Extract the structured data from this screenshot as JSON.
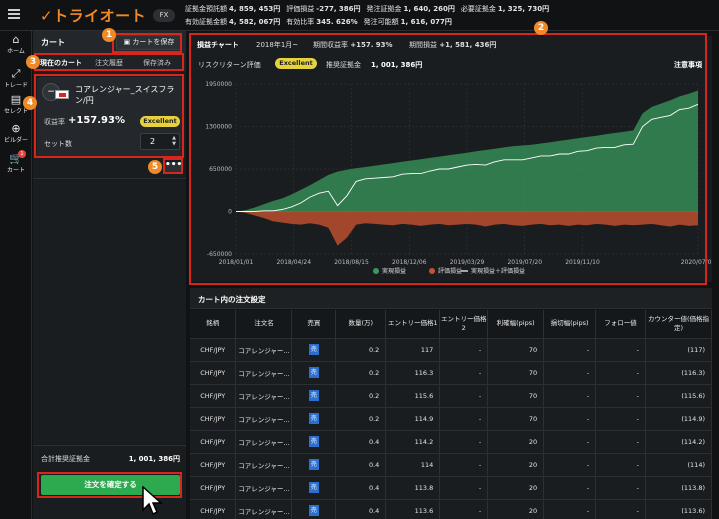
{
  "header": {
    "brand": "トライオート",
    "product_tag": "FX",
    "stats_row1": [
      {
        "label": "証拠金預託額",
        "value": "4, 859, 453円"
      },
      {
        "label": "評価損益",
        "value": "-277, 386円"
      },
      {
        "label": "発注証拠金",
        "value": "1, 640, 260円"
      },
      {
        "label": "必要証拠金",
        "value": "1, 325, 730円"
      }
    ],
    "stats_row2": [
      {
        "label": "有効証拠金額",
        "value": "4, 582, 067円"
      },
      {
        "label": "有効比率",
        "value": "345. 626%"
      },
      {
        "label": "発注可能額",
        "value": "1, 616, 077円"
      }
    ]
  },
  "rail": {
    "items": [
      {
        "label": "ホーム",
        "icon": "home-icon",
        "glyph": "⌂"
      },
      {
        "label": "トレード",
        "icon": "trade-icon",
        "glyph": "⤢"
      },
      {
        "label": "セレクト",
        "icon": "select-icon",
        "glyph": "▤"
      },
      {
        "label": "ビルダー",
        "icon": "builder-icon",
        "glyph": "⊕"
      },
      {
        "label": "カート",
        "icon": "cart-icon",
        "glyph": "🛒",
        "badge": "1"
      }
    ]
  },
  "cart": {
    "title": "カート",
    "save_label": "カートを保存",
    "tabs": [
      "現在のカート",
      "注文履歴",
      "保存済み"
    ],
    "item": {
      "name": "コアレンジャー_スイスフラン/円",
      "profit_label": "収益率",
      "profit_value": "+157.93%",
      "rating": "Excellent",
      "sets_label": "セット数",
      "sets_value": "2"
    },
    "more_label": "•••",
    "total_label": "合計推奨証拠金",
    "total_value": "1, 001, 386円",
    "confirm_label": "注文を確定する"
  },
  "markers": [
    "1",
    "2",
    "3",
    "4",
    "5"
  ],
  "chart_tabs": {
    "active": "損益チャート",
    "period": "2018年1月~",
    "return_label": "期間収益率",
    "return_value": "+157. 93%",
    "pnl_label": "期間損益",
    "pnl_value": "+1, 581, 436円"
  },
  "chart_info": {
    "risk_label": "リスクリターン評価",
    "risk_value": "Excellent",
    "rec_label": "推奨証拠金",
    "rec_value": "1, 001, 386円",
    "notes_label": "注意事項"
  },
  "chart_data": {
    "type": "area",
    "x_ticks": [
      "2018/01/01",
      "2018/04/24",
      "2018/08/15",
      "2018/12/06",
      "2019/03/29",
      "2019/07/20",
      "2019/11/10",
      "2020/07/06"
    ],
    "y_ticks": [
      1950000,
      1300000,
      650000,
      0,
      -650000
    ],
    "y_tick_labels": [
      "1950000",
      "1300000",
      "650000",
      "0",
      "-650000"
    ],
    "ylim": [
      -650000,
      1950000
    ],
    "grid": true,
    "legend_position": "bottom",
    "series": [
      {
        "name": "実現損益",
        "color": "#3a9a5c",
        "values": [
          0,
          20000,
          60000,
          110000,
          160000,
          200000,
          260000,
          330000,
          400000,
          480000,
          560000,
          610000,
          640000,
          660000,
          680000,
          700000,
          720000,
          740000,
          760000,
          780000,
          800000,
          820000,
          840000,
          860000,
          880000,
          900000,
          920000,
          940000,
          960000,
          980000,
          1000000,
          1010000,
          1020000,
          1040000,
          1060000,
          1080000,
          1100000,
          1120000,
          1140000,
          1160000,
          1180000,
          1200000,
          1220000,
          1240000,
          1500000,
          1600000,
          1650000,
          1700000,
          1760000,
          1800000,
          1850000
        ]
      },
      {
        "name": "評価損益",
        "color": "#c4532e",
        "values": [
          0,
          -20000,
          -60000,
          -100000,
          -150000,
          -170000,
          -190000,
          -200000,
          -180000,
          -200000,
          -250000,
          -520000,
          -400000,
          -200000,
          -180000,
          -190000,
          -200000,
          -210000,
          -190000,
          -200000,
          -220000,
          -200000,
          -190000,
          -210000,
          -200000,
          -190000,
          -200000,
          -230000,
          -200000,
          -190000,
          -210000,
          -220000,
          -200000,
          -190000,
          -210000,
          -200000,
          -220000,
          -200000,
          -210000,
          -190000,
          -200000,
          -220000,
          -200000,
          -210000,
          -200000,
          -190000,
          -210000,
          -230000,
          -200000,
          -220000,
          -210000
        ]
      },
      {
        "name": "実現損益＋評価損益",
        "color": "#ffffff",
        "values": [
          0,
          0,
          0,
          10000,
          10000,
          30000,
          70000,
          130000,
          220000,
          280000,
          310000,
          90000,
          240000,
          460000,
          500000,
          510000,
          520000,
          530000,
          570000,
          580000,
          580000,
          620000,
          650000,
          650000,
          680000,
          710000,
          720000,
          710000,
          760000,
          790000,
          790000,
          790000,
          820000,
          850000,
          850000,
          880000,
          880000,
          920000,
          930000,
          970000,
          980000,
          980000,
          1020000,
          1030000,
          1300000,
          1410000,
          1440000,
          1470000,
          1560000,
          1580000,
          1640000
        ]
      }
    ]
  },
  "order": {
    "title": "カート内の注文設定",
    "columns": [
      "銘柄",
      "注文名",
      "売買",
      "数量(万)",
      "エントリー価格1",
      "エントリー価格2",
      "利確幅(pips)",
      "損切幅(pips)",
      "フォロー値",
      "カウンター値(価格指定)"
    ],
    "rows": [
      [
        "CHF/JPY",
        "コアレンジャー...",
        "売",
        "0.2",
        "117",
        "-",
        "70",
        "-",
        "-",
        "(117)"
      ],
      [
        "CHF/JPY",
        "コアレンジャー...",
        "売",
        "0.2",
        "116.3",
        "-",
        "70",
        "-",
        "-",
        "(116.3)"
      ],
      [
        "CHF/JPY",
        "コアレンジャー...",
        "売",
        "0.2",
        "115.6",
        "-",
        "70",
        "-",
        "-",
        "(115.6)"
      ],
      [
        "CHF/JPY",
        "コアレンジャー...",
        "売",
        "0.2",
        "114.9",
        "-",
        "70",
        "-",
        "-",
        "(114.9)"
      ],
      [
        "CHF/JPY",
        "コアレンジャー...",
        "売",
        "0.4",
        "114.2",
        "-",
        "20",
        "-",
        "-",
        "(114.2)"
      ],
      [
        "CHF/JPY",
        "コアレンジャー...",
        "売",
        "0.4",
        "114",
        "-",
        "20",
        "-",
        "-",
        "(114)"
      ],
      [
        "CHF/JPY",
        "コアレンジャー...",
        "売",
        "0.4",
        "113.8",
        "-",
        "20",
        "-",
        "-",
        "(113.8)"
      ],
      [
        "CHF/JPY",
        "コアレンジャー...",
        "売",
        "0.4",
        "113.6",
        "-",
        "20",
        "-",
        "-",
        "(113.6)"
      ]
    ]
  }
}
